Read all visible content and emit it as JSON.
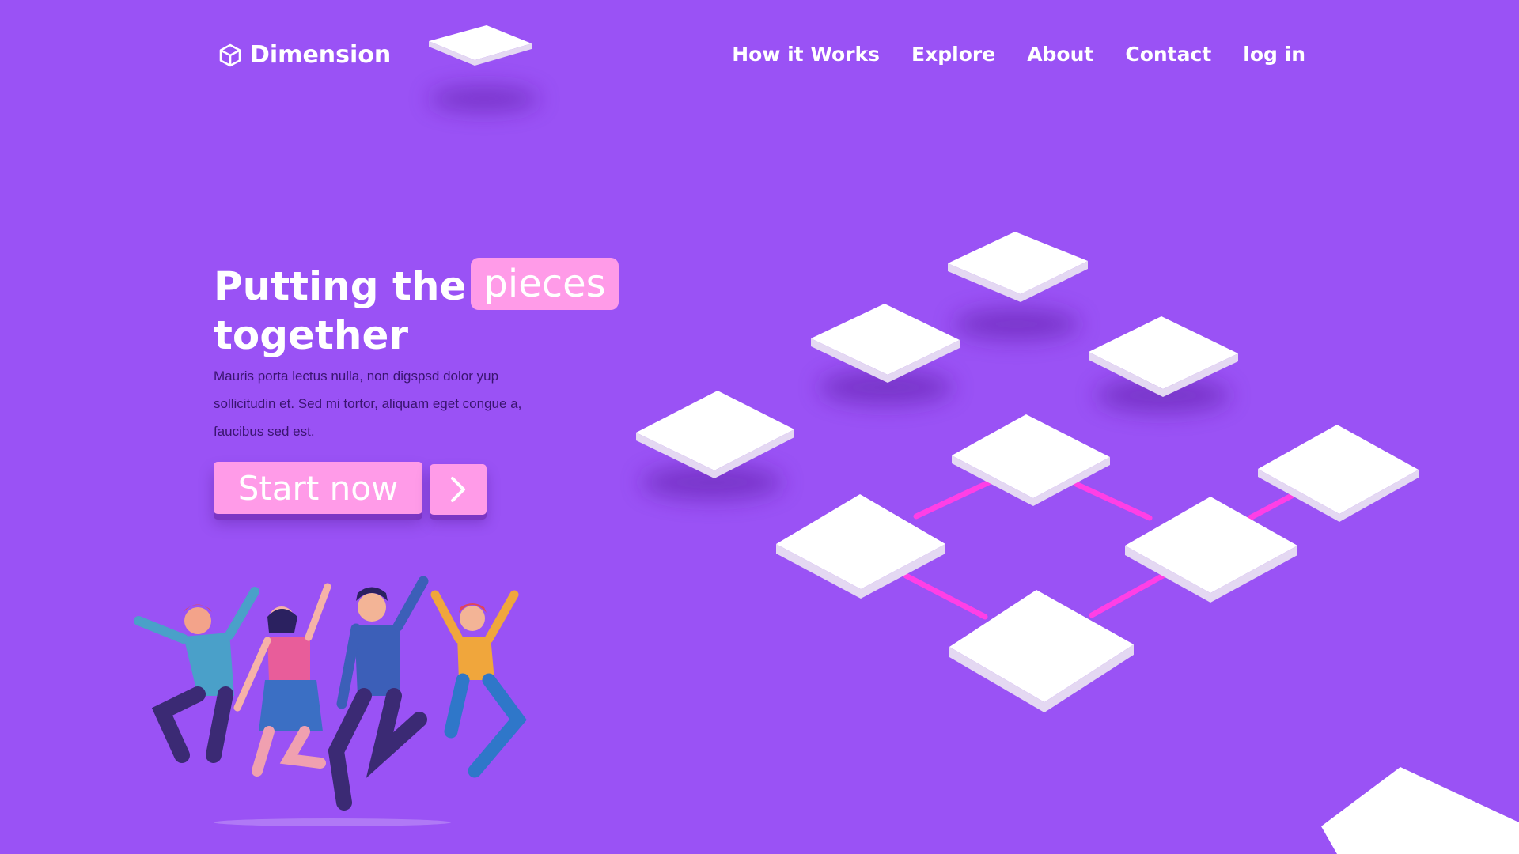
{
  "brand": {
    "name": "Dimension",
    "logo_icon": "cube-icon"
  },
  "nav": {
    "links": [
      "How it Works",
      "Explore",
      "About",
      "Contact",
      "log in"
    ]
  },
  "hero": {
    "title_start": "Putting the",
    "title_highlight": "pieces",
    "title_end": "together",
    "description": "Mauris porta lectus nulla, non digspsd dolor  yup sollicitudin et. Sed mi tortor, aliquam eget congue a, faucibus sed est.",
    "cta_label": "Start now",
    "cta_arrow_icon": "chevron-right-icon"
  },
  "colors": {
    "background": "#9a52f5",
    "accent_pink": "#ff9be8",
    "connector_magenta": "#ff3fe6",
    "tile_white": "#ffffff"
  }
}
